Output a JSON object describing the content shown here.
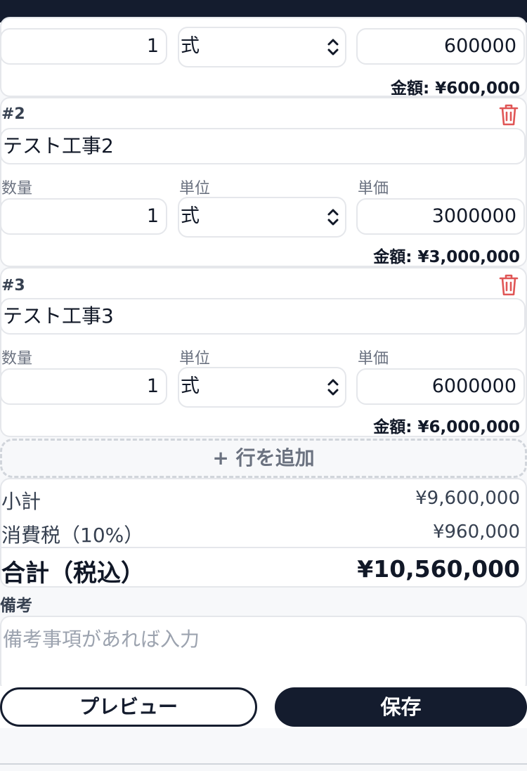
{
  "items": [
    {
      "quantity": "1",
      "unit": "式",
      "unit_price": "600000",
      "amount_label": "金額:",
      "amount": "¥600,000"
    },
    {
      "number": "#2",
      "name": "テスト工事2",
      "quantity_label": "数量",
      "unit_label": "単位",
      "unit_price_label": "単価",
      "quantity": "1",
      "unit": "式",
      "unit_price": "3000000",
      "amount_label": "金額:",
      "amount": "¥3,000,000"
    },
    {
      "number": "#3",
      "name": "テスト工事3",
      "quantity_label": "数量",
      "unit_label": "単位",
      "unit_price_label": "単価",
      "quantity": "1",
      "unit": "式",
      "unit_price": "6000000",
      "amount_label": "金額:",
      "amount": "¥6,000,000"
    }
  ],
  "add_row_label": "+ 行を追加",
  "totals": {
    "subtotal_label": "小計",
    "subtotal": "¥9,600,000",
    "tax_label": "消費税（10%）",
    "tax": "¥960,000",
    "grand_label": "合計（税込）",
    "grand": "¥10,560,000"
  },
  "remarks": {
    "label": "備考",
    "placeholder": "備考事項があれば入力"
  },
  "buttons": {
    "preview": "プレビュー",
    "save": "保存"
  },
  "icon_names": [
    "chevron-updown-icon",
    "trash-icon"
  ],
  "colors": {
    "dark": "#141c2e",
    "delete": "#e05656",
    "border": "#e5e7eb"
  }
}
